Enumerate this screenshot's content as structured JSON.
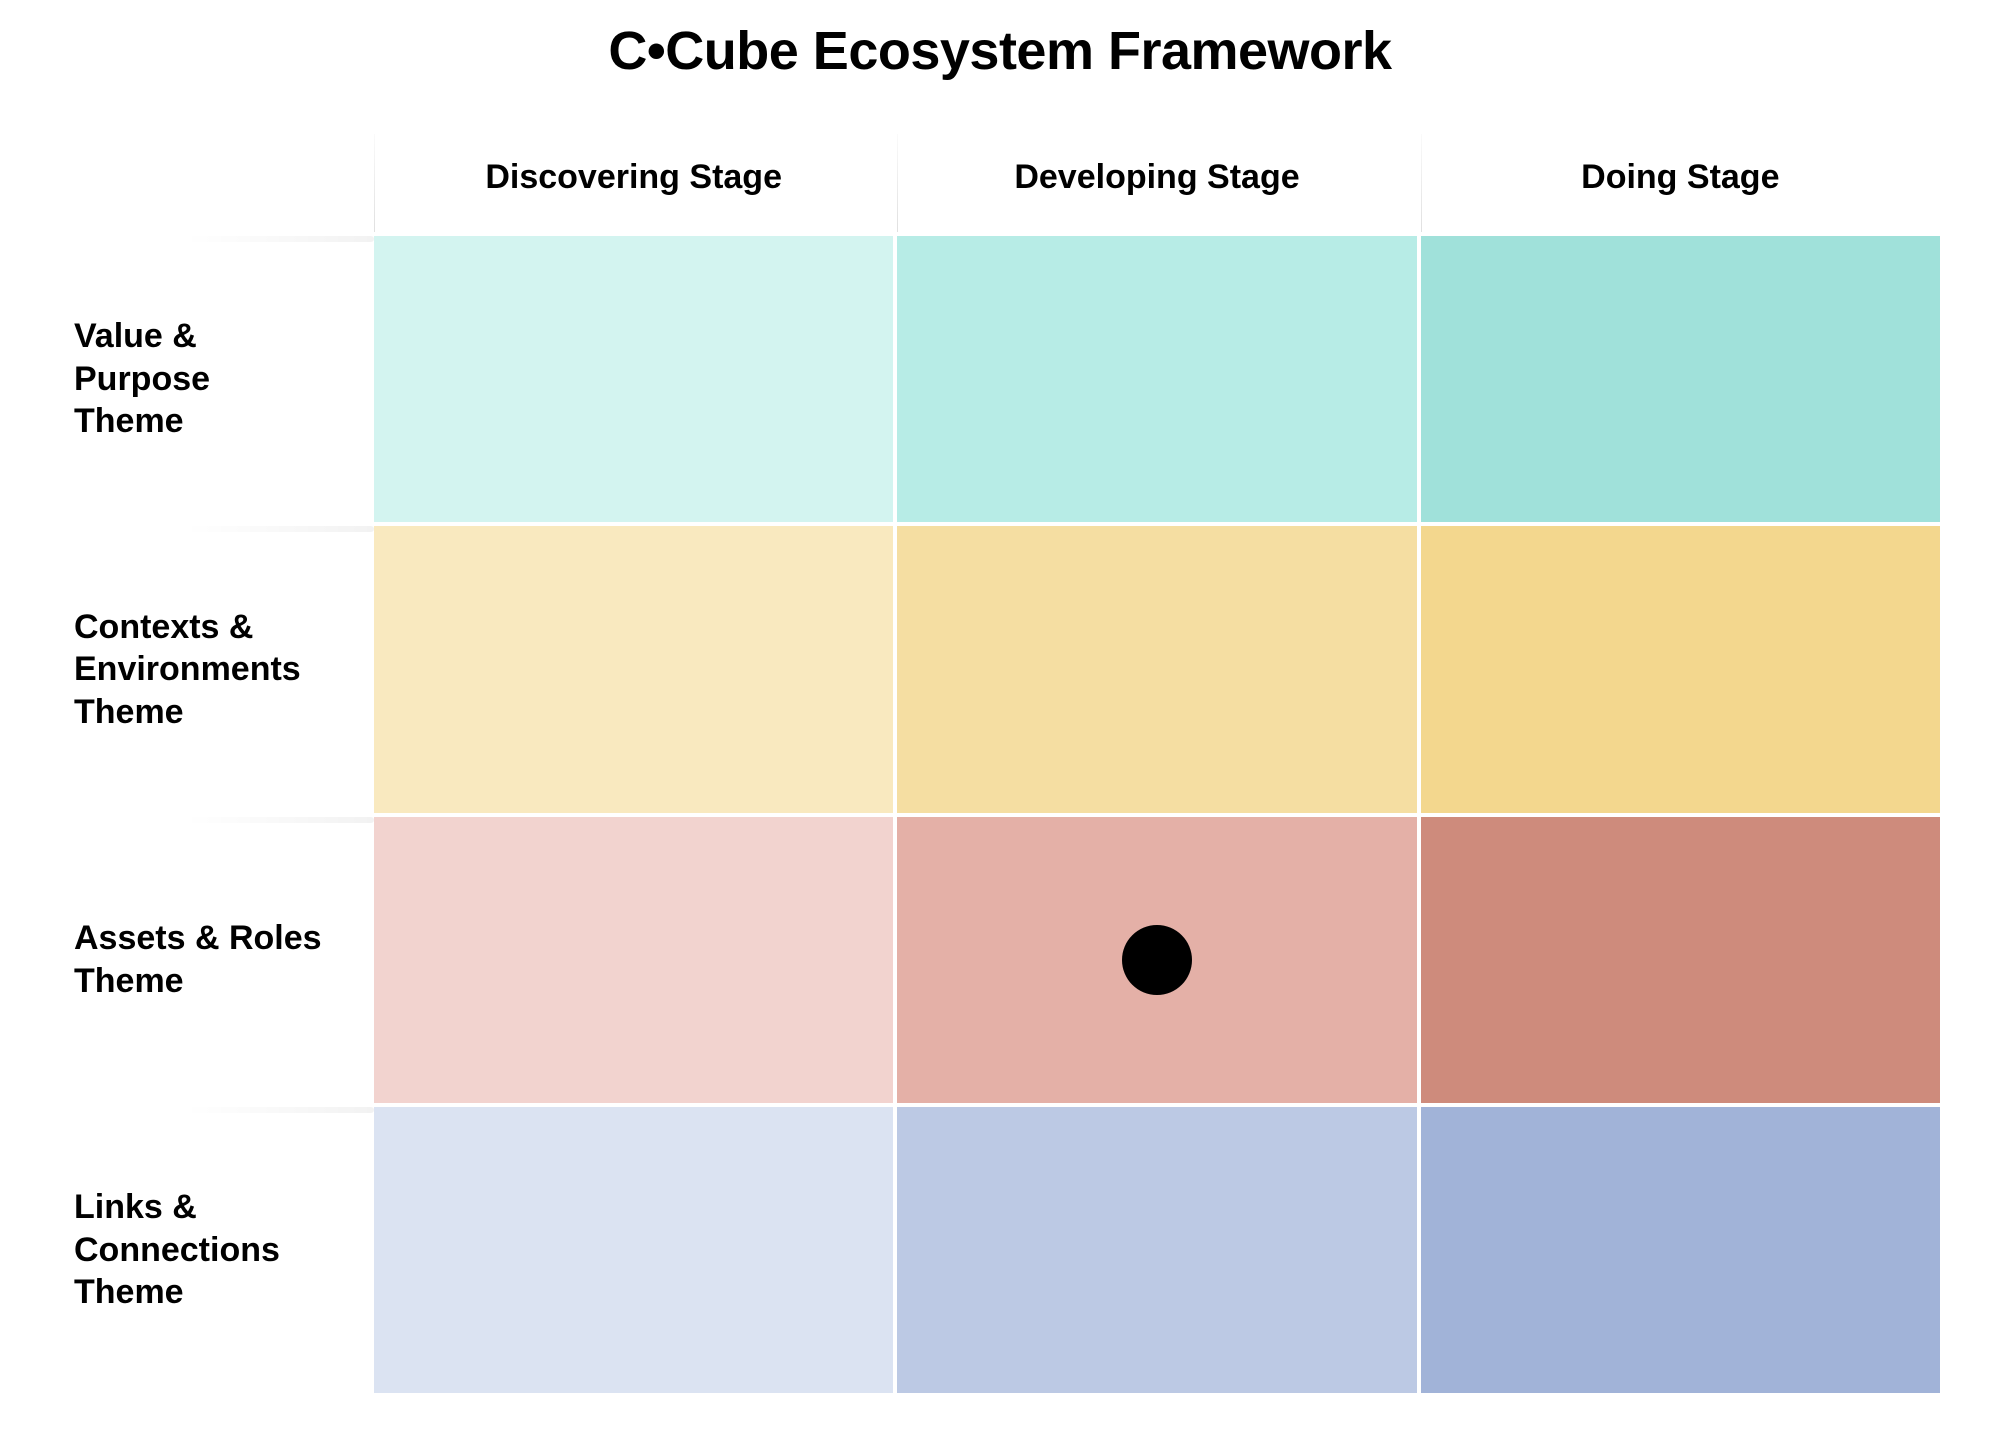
{
  "title": "C•Cube Ecosystem Framework",
  "columns": [
    {
      "label": "Discovering Stage"
    },
    {
      "label": "Developing Stage"
    },
    {
      "label": "Doing Stage"
    }
  ],
  "rows": [
    {
      "label": "Value & Purpose\nTheme",
      "colors": [
        "#d3f4f0",
        "#b7ece6",
        "#a0e1da"
      ]
    },
    {
      "label": "Contexts &\nEnvironments\nTheme",
      "colors": [
        "#f9e9bf",
        "#f5dea2",
        "#f3d78e"
      ]
    },
    {
      "label": "Assets & Roles\nTheme",
      "colors": [
        "#f2d3cf",
        "#e4b0a7",
        "#ce8b7c"
      ]
    },
    {
      "label": "Links &\nConnections\nTheme",
      "colors": [
        "#dbe3f2",
        "#bcc9e4",
        "#a1b3d8"
      ]
    }
  ],
  "marker": {
    "row_index": 2,
    "col_index": 1
  }
}
